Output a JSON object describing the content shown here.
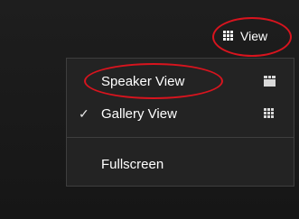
{
  "toolbar": {
    "view_label": "View",
    "view_icon": "grid-icon"
  },
  "menu": {
    "items": [
      {
        "label": "Speaker View",
        "checked": false,
        "icon": "speaker-view-icon"
      },
      {
        "label": "Gallery View",
        "checked": true,
        "check_mark": "✓",
        "icon": "gallery-view-icon"
      },
      {
        "label": "Fullscreen",
        "checked": false
      }
    ]
  },
  "colors": {
    "background": "#1a1a1a",
    "menu_background": "#232323",
    "annotation": "#d8141e",
    "text": "#ffffff"
  }
}
